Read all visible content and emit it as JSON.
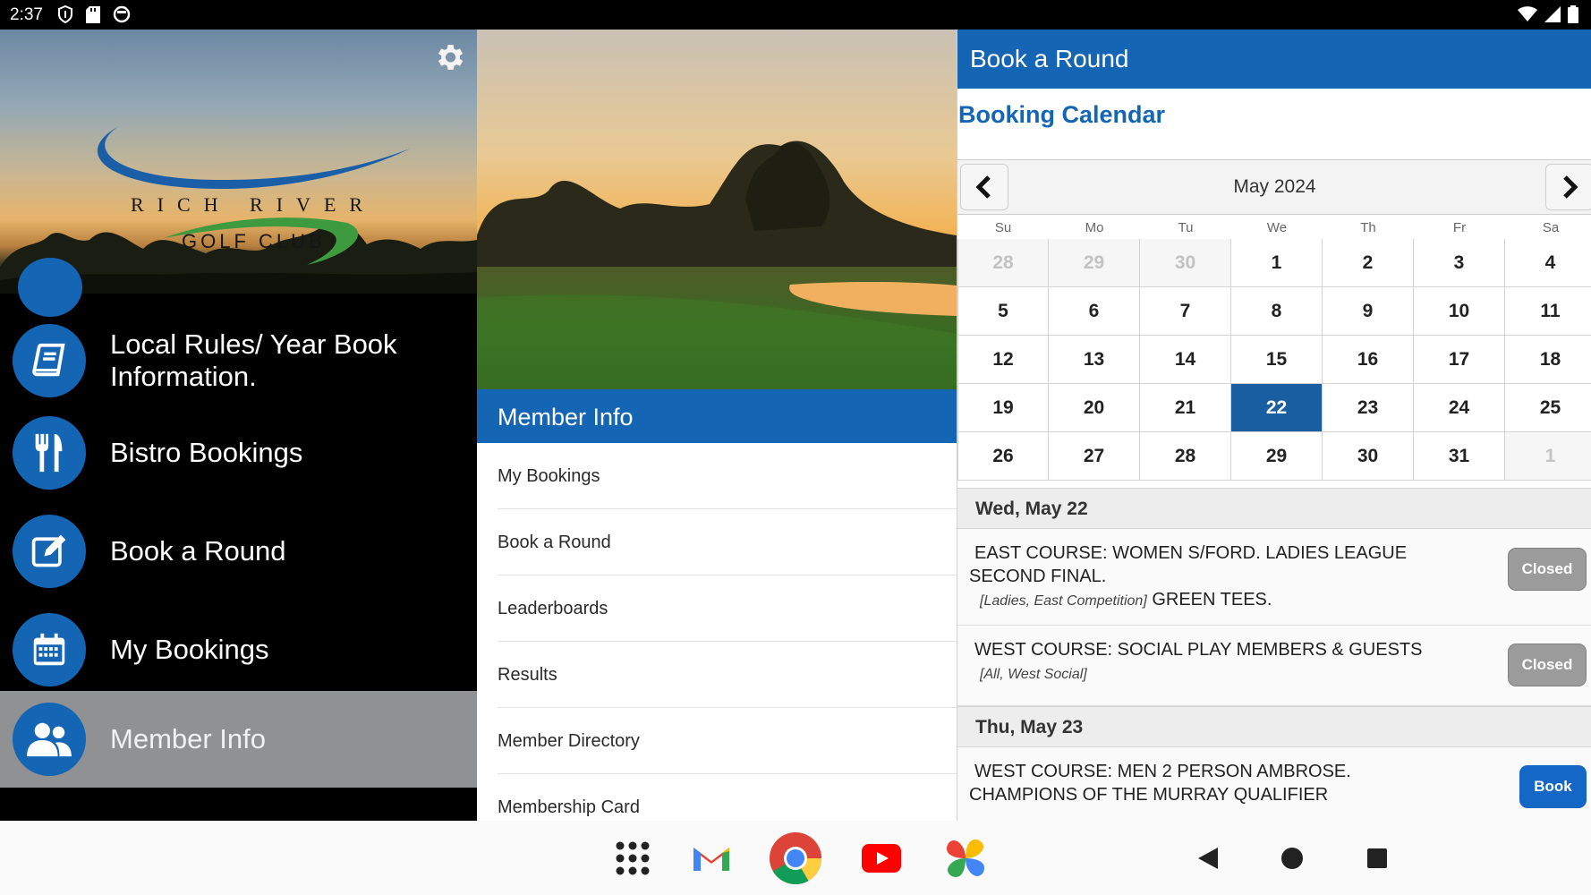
{
  "status_bar": {
    "time": "2:37"
  },
  "drawer": {
    "logo": {
      "line1": "RICH RIVER",
      "line2": "GOLF CLUB"
    },
    "items": [
      {
        "label": "Local Rules/ Year Book Information.",
        "icon": "book-icon"
      },
      {
        "label": "Bistro Bookings",
        "icon": "fork-knife-icon"
      },
      {
        "label": "Book a Round",
        "icon": "edit-icon"
      },
      {
        "label": "My Bookings",
        "icon": "calendar-icon"
      },
      {
        "label": "Member Info",
        "icon": "members-icon",
        "active": true
      }
    ]
  },
  "middle": {
    "header": "Member Info",
    "items": [
      "My Bookings",
      "Book a Round",
      "Leaderboards",
      "Results",
      "Member Directory",
      "Membership Card"
    ]
  },
  "right": {
    "header": "Book a Round",
    "subtitle": "Booking Calendar",
    "calendar": {
      "month_label": "May 2024",
      "weekdays": [
        "Su",
        "Mo",
        "Tu",
        "We",
        "Th",
        "Fr",
        "Sa"
      ],
      "days": [
        {
          "d": "28",
          "muted": true
        },
        {
          "d": "29",
          "muted": true
        },
        {
          "d": "30",
          "muted": true
        },
        {
          "d": "1"
        },
        {
          "d": "2"
        },
        {
          "d": "3"
        },
        {
          "d": "4"
        },
        {
          "d": "5"
        },
        {
          "d": "6"
        },
        {
          "d": "7"
        },
        {
          "d": "8"
        },
        {
          "d": "9"
        },
        {
          "d": "10"
        },
        {
          "d": "11"
        },
        {
          "d": "12"
        },
        {
          "d": "13"
        },
        {
          "d": "14"
        },
        {
          "d": "15"
        },
        {
          "d": "16"
        },
        {
          "d": "17"
        },
        {
          "d": "18"
        },
        {
          "d": "19"
        },
        {
          "d": "20"
        },
        {
          "d": "21"
        },
        {
          "d": "22",
          "selected": true
        },
        {
          "d": "23"
        },
        {
          "d": "24"
        },
        {
          "d": "25"
        },
        {
          "d": "26"
        },
        {
          "d": "27"
        },
        {
          "d": "28"
        },
        {
          "d": "29"
        },
        {
          "d": "30"
        },
        {
          "d": "31"
        },
        {
          "d": "1",
          "muted": true
        }
      ]
    },
    "days": [
      {
        "label": "Wed, May 22",
        "events": [
          {
            "title": "EAST COURSE: WOMEN S/FORD. LADIES LEAGUE SECOND FINAL.",
            "tags": "[Ladies, East Competition]",
            "tail": "GREEN TEES.",
            "button": "Closed"
          },
          {
            "title": "WEST COURSE: SOCIAL PLAY MEMBERS & GUESTS",
            "tags": "[All, West Social]",
            "tail": "",
            "button": "Closed"
          }
        ]
      },
      {
        "label": "Thu, May 23",
        "events": [
          {
            "title": "WEST COURSE: MEN 2 PERSON AMBROSE. CHAMPIONS OF THE MURRAY QUALIFIER",
            "tags": "",
            "tail": "",
            "button": "Book"
          }
        ]
      }
    ]
  },
  "colors": {
    "brand_blue": "#1565b5",
    "selected_day": "#1a5ea2",
    "closed_button": "#9b9b9b",
    "book_button": "#1567c6"
  }
}
